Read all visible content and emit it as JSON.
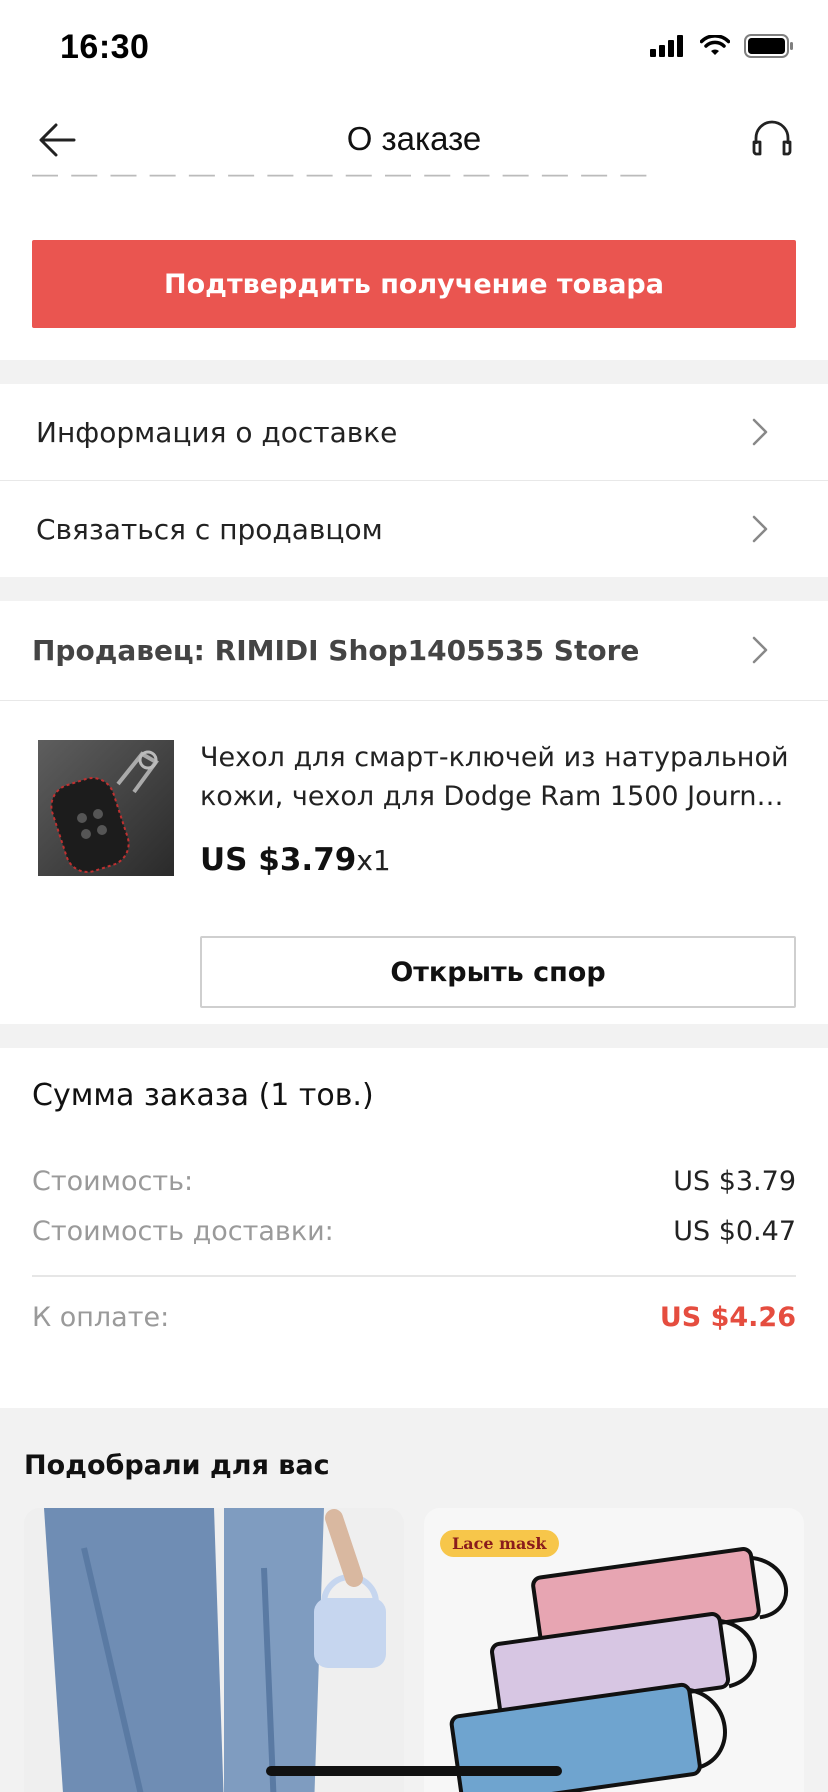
{
  "status_bar": {
    "time": "16:30",
    "icons": [
      "cellular-signal-icon",
      "wifi-icon",
      "battery-icon"
    ]
  },
  "nav": {
    "title": "О заказе",
    "back_icon": "arrow-left-icon",
    "support_icon": "headset-icon"
  },
  "confirm_button": "Подтвердить получение товара",
  "menu": {
    "delivery_info": "Информация о доставке",
    "contact_seller": "Связаться с продавцом"
  },
  "seller": {
    "label": "Продавец: RIMIDI Shop1405535 Store"
  },
  "product": {
    "title_line1": "Чехол для смарт-ключей из натуральной",
    "title_line2": "кожи, чехол для Dodge Ram 1500 Journey...",
    "price": "US $3.79",
    "quantity": "x1",
    "dispute_button": "Открыть спор"
  },
  "summary": {
    "title": "Сумма заказа (1 тов.)",
    "cost_label": "Стоимость:",
    "cost_value": "US $3.79",
    "shipping_label": "Стоимость доставки:",
    "shipping_value": "US $0.47",
    "total_label": "К оплате:",
    "total_value": "US $4.26"
  },
  "recommendations": {
    "title": "Подобрали для вас",
    "card2_badge": "Lace mask"
  },
  "colors": {
    "accent_red": "#ea5550",
    "total_red": "#e54d3f",
    "section_gap": "#f2f2f2"
  }
}
